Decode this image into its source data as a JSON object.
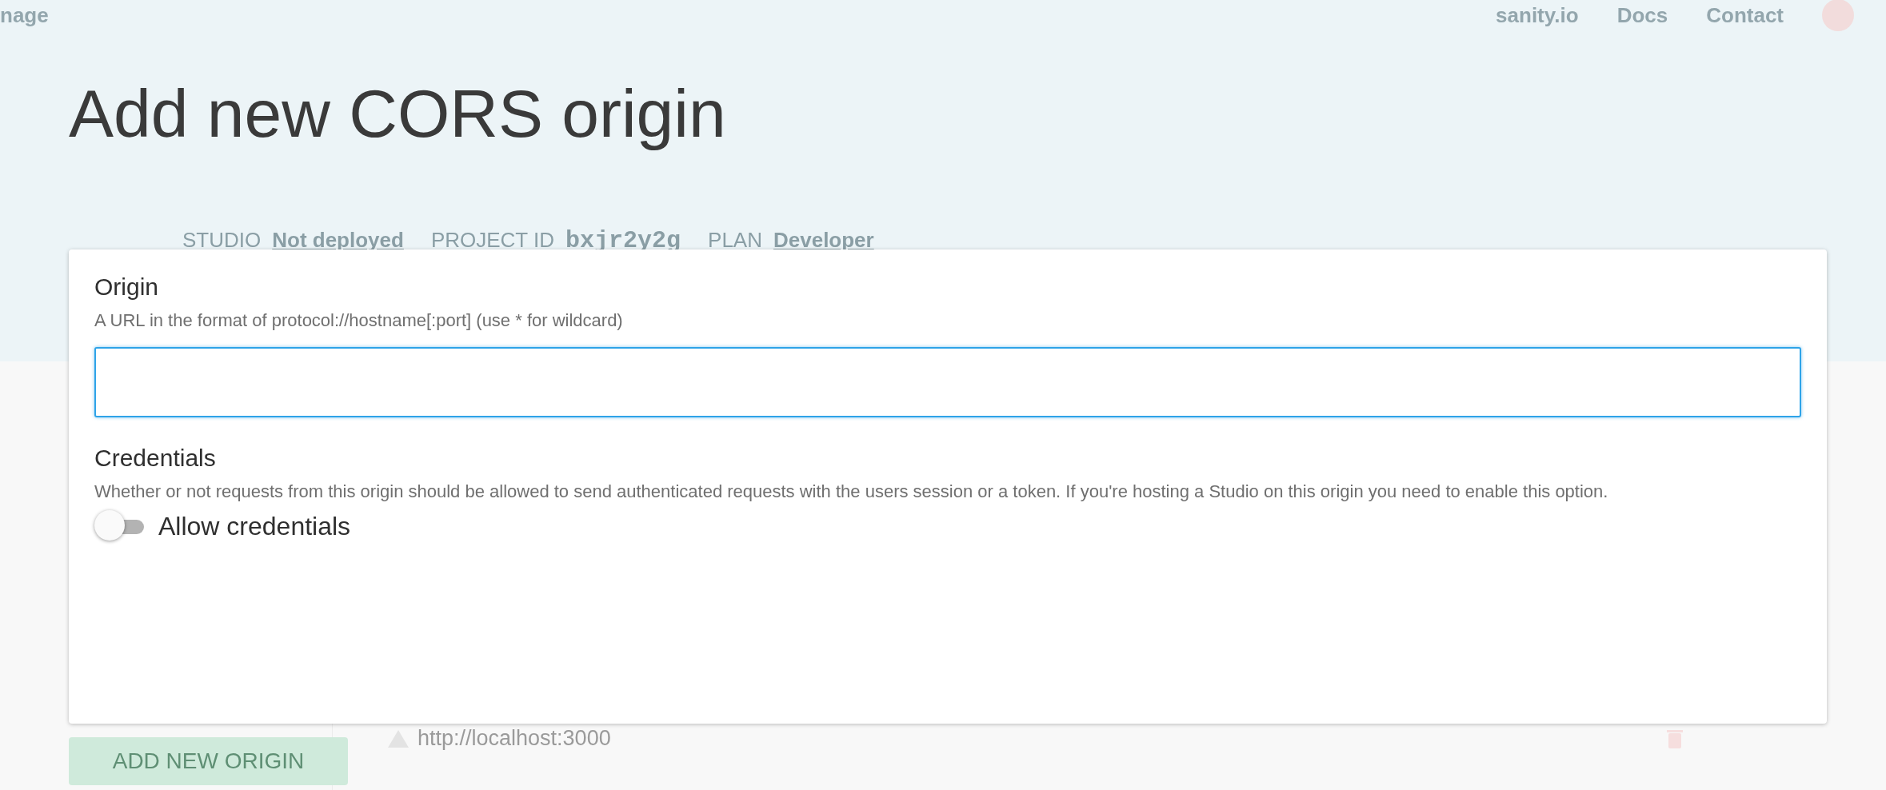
{
  "background": {
    "nav": {
      "brand": "nage",
      "links": [
        "sanity.io",
        "Docs",
        "Contact"
      ]
    },
    "project": {
      "meta": [
        {
          "label": "STUDIO",
          "value": "Not deployed",
          "kind": "link"
        },
        {
          "label": "PROJECT ID",
          "value": "bxjr2y2g",
          "kind": "code"
        },
        {
          "label": "PLAN",
          "value": "Developer",
          "kind": "link"
        }
      ]
    },
    "add_button": "ADD NEW ORIGIN",
    "origins": [
      {
        "url": "http://localhost:3000"
      }
    ]
  },
  "dialog": {
    "title": "Add new CORS origin",
    "origin": {
      "label": "Origin",
      "hint": "A URL in the format of protocol://hostname[:port] (use * for wildcard)"
    },
    "credentials": {
      "label": "Credentials",
      "hint": "Whether or not requests from this origin should be allowed to send authenticated requests with the users session or a token. If you're hosting a Studio on this origin you need to enable this option.",
      "toggle_label": "Allow credentials",
      "on": false
    }
  }
}
